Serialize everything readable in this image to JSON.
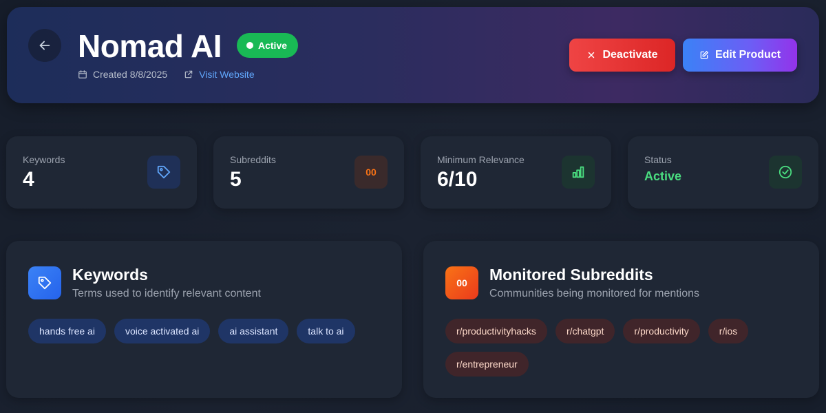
{
  "header": {
    "title": "Nomad AI",
    "status_label": "Active",
    "created": "Created 8/8/2025",
    "website_label": "Visit Website",
    "deactivate_label": "Deactivate",
    "edit_label": "Edit Product"
  },
  "stats": [
    {
      "label": "Keywords",
      "value": "4",
      "icon": "tag-icon"
    },
    {
      "label": "Subreddits",
      "value": "5",
      "icon": "reddit-icon",
      "icon_text": "00"
    },
    {
      "label": "Minimum Relevance",
      "value": "6/10",
      "icon": "bar-chart-icon"
    },
    {
      "label": "Status",
      "value": "Active",
      "icon": "check-circle-icon"
    }
  ],
  "keywords_card": {
    "title": "Keywords",
    "subtitle": "Terms used to identify relevant content",
    "items": [
      "hands free ai",
      "voice activated ai",
      "ai assistant",
      "talk to ai"
    ]
  },
  "subreddits_card": {
    "title": "Monitored Subreddits",
    "subtitle": "Communities being monitored for mentions",
    "icon_text": "00",
    "items": [
      "r/productivityhacks",
      "r/chatgpt",
      "r/productivity",
      "r/ios",
      "r/entrepreneur"
    ]
  },
  "colors": {
    "active_green": "#19b955",
    "deactivate_red": "#ef4444",
    "edit_gradient_start": "#3b82f6",
    "edit_gradient_end": "#9333ea",
    "link_blue": "#60a5fa",
    "subreddit_orange": "#f97316"
  }
}
